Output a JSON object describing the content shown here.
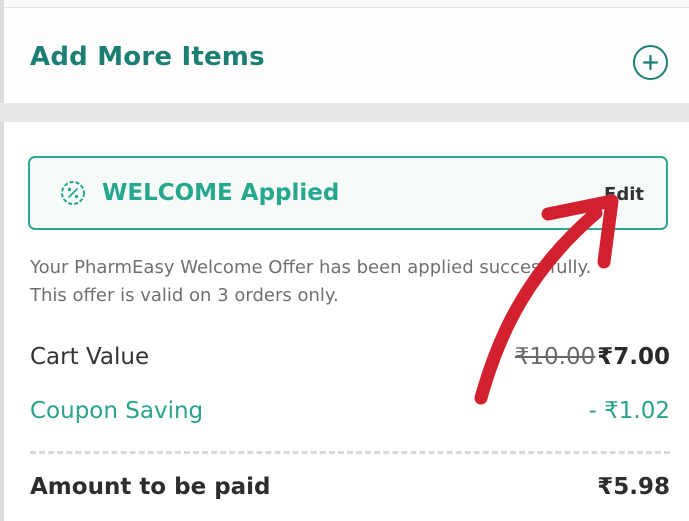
{
  "add_more": {
    "title": "Add More Items",
    "icon": "plus-circle-icon"
  },
  "coupon": {
    "icon": "percent-badge-icon",
    "applied_text": "WELCOME Applied",
    "edit_label": "Edit",
    "description_line1": "Your PharmEasy Welcome Offer has been applied successfully.",
    "description_line2": "This offer is valid on 3 orders only."
  },
  "bill": {
    "cart_value_label": "Cart Value",
    "cart_value_original": "₹10.00",
    "cart_value_final": "₹7.00",
    "coupon_saving_label": "Coupon Saving",
    "coupon_saving_value": "- ₹1.02",
    "amount_label": "Amount to be paid",
    "amount_value": "₹5.98"
  },
  "colors": {
    "brand_teal": "#1b7f74",
    "accent_green": "#27a78d",
    "arrow_red": "#d3202f"
  }
}
